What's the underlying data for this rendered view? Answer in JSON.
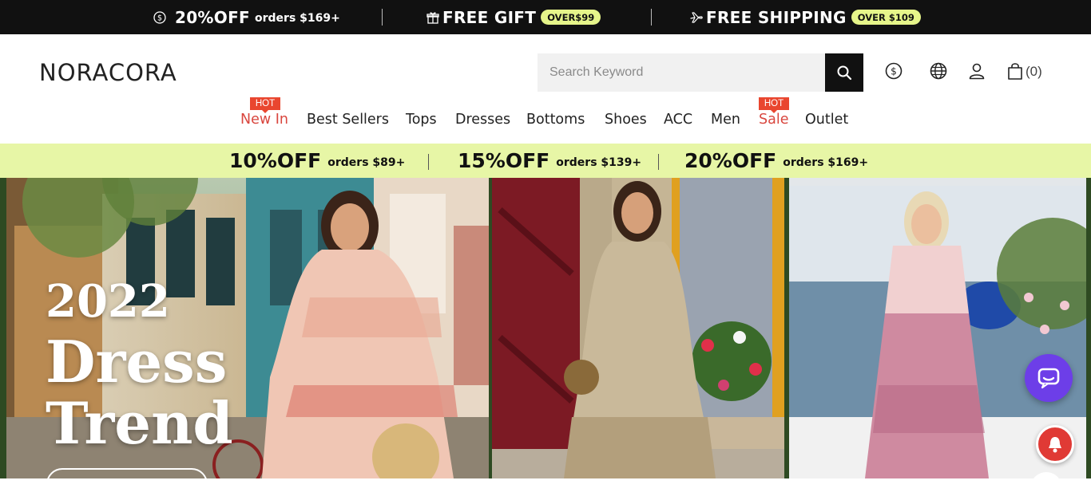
{
  "announcement": {
    "discount": {
      "big": "20%OFF",
      "small": "orders $169+"
    },
    "gift": {
      "big": "FREE GIFT",
      "pill": "OVER$99"
    },
    "shipping": {
      "big": "FREE SHIPPING",
      "pill": "OVER $109"
    }
  },
  "header": {
    "logo": "NORACORA",
    "search_placeholder": "Search Keyword",
    "cart_count": "(0)"
  },
  "nav": {
    "items": [
      {
        "label": "New In",
        "hot": true,
        "highlight": true
      },
      {
        "label": "Best Sellers"
      },
      {
        "label": "Tops"
      },
      {
        "label": "Dresses"
      },
      {
        "label": "Bottoms"
      },
      {
        "label": "Shoes"
      },
      {
        "label": "ACC"
      },
      {
        "label": "Men"
      },
      {
        "label": "Sale",
        "hot": true,
        "highlight": true
      },
      {
        "label": "Outlet"
      }
    ],
    "hot_label": "HOT"
  },
  "promo": {
    "tiers": [
      {
        "big": "10%OFF",
        "small": "orders $89+"
      },
      {
        "big": "15%OFF",
        "small": "orders $139+"
      },
      {
        "big": "20%OFF",
        "small": "orders $169+"
      }
    ]
  },
  "hero": {
    "year": "2022",
    "line1": "Dress",
    "line2": "Trend"
  },
  "colors": {
    "topbar": "#111111",
    "accent_pill": "#e6f58a",
    "promo_bg": "#e7f6a6",
    "hot_badge": "#e9462f",
    "nav_highlight": "#d9463e",
    "chat": "#6d3ee8",
    "notification": "#e03a35"
  },
  "icons": [
    "dollar-icon",
    "gift-icon",
    "plane-icon",
    "search-icon",
    "currency-icon",
    "globe-icon",
    "user-icon",
    "bag-icon",
    "chat-icon",
    "bell-icon"
  ]
}
